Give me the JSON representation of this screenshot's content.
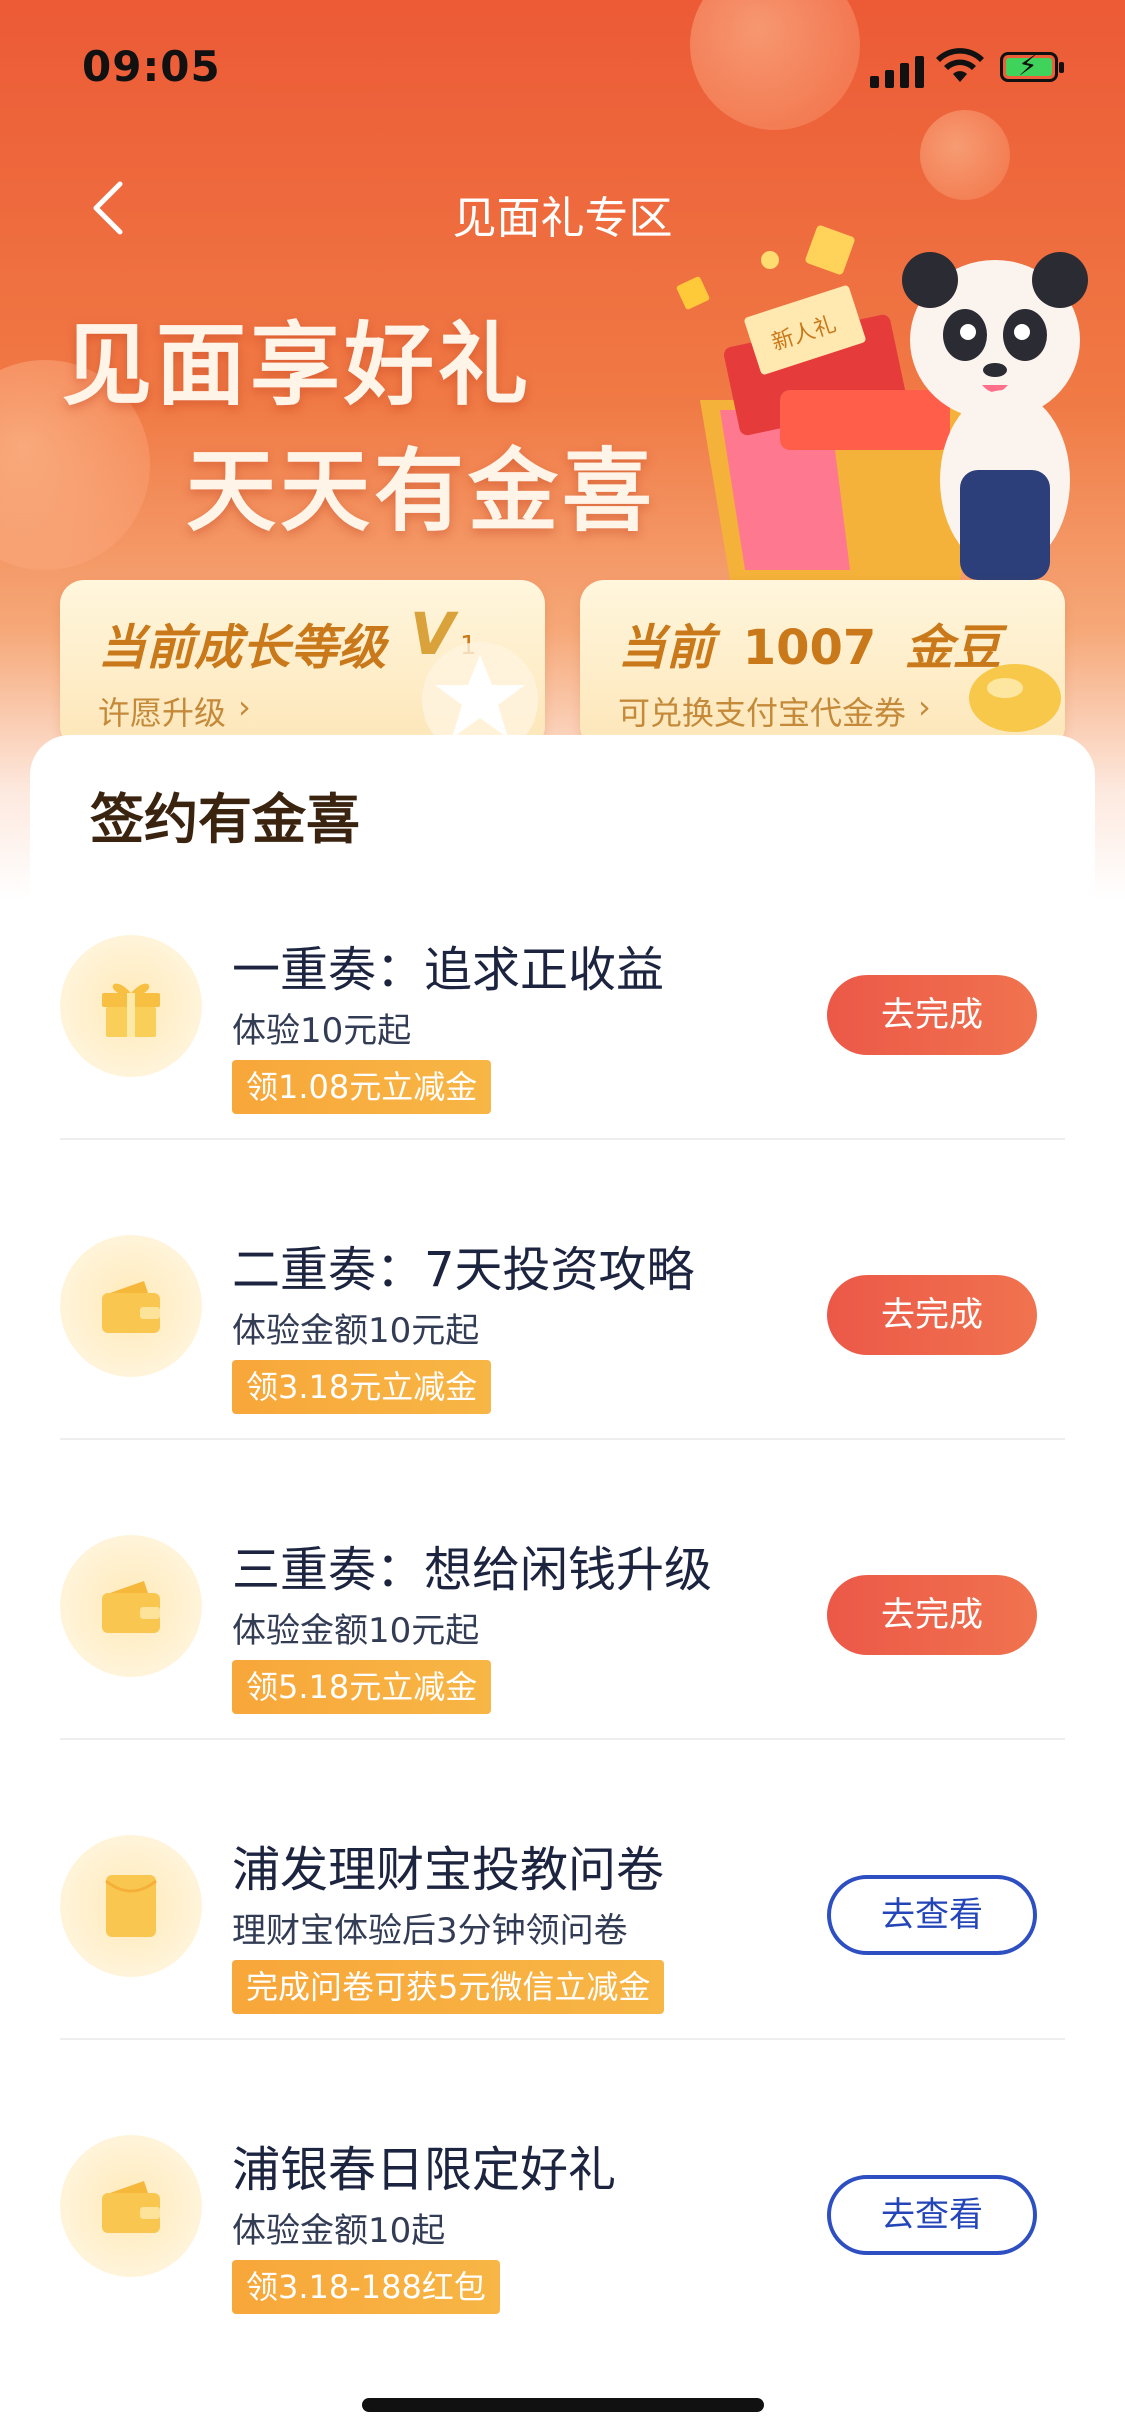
{
  "status_bar": {
    "time": "09:05"
  },
  "nav": {
    "title": "见面礼专区"
  },
  "hero": {
    "slogan_line1": "见面享好礼",
    "slogan_line2": "天天有金喜",
    "mascot_tag": "新人礼"
  },
  "growth_card": {
    "title": "当前成长等级",
    "level_badge": "V",
    "level_sub": "1",
    "link": "许愿升级"
  },
  "bean_card": {
    "prefix": "当前",
    "amount": "1007",
    "unit": "金豆",
    "link": "可兑换支付宝代金券"
  },
  "section": {
    "title": "签约有金喜"
  },
  "tasks": [
    {
      "icon": "gift-icon",
      "title": "一重奏：追求正收益",
      "subtitle": "体验10元起",
      "tag": "领1.08元立减金",
      "button": "去完成",
      "button_style": "done"
    },
    {
      "icon": "wallet-icon",
      "title": "二重奏：7天投资攻略",
      "subtitle": "体验金额10元起",
      "tag": "领3.18元立减金",
      "button": "去完成",
      "button_style": "done"
    },
    {
      "icon": "wallet-icon",
      "title": "三重奏：想给闲钱升级",
      "subtitle": "体验金额10元起",
      "tag": "领5.18元立减金",
      "button": "去完成",
      "button_style": "done"
    },
    {
      "icon": "envelope-icon",
      "title": "浦发理财宝投教问卷",
      "subtitle": "理财宝体验后3分钟领问卷",
      "tag": "完成问卷可获5元微信立减金",
      "button": "去查看",
      "button_style": "view"
    },
    {
      "icon": "wallet-icon",
      "title": "浦银春日限定好礼",
      "subtitle": "体验金额10起",
      "tag": "领3.18-188红包",
      "button": "去查看",
      "button_style": "view"
    }
  ],
  "colors": {
    "accent_red": "#ec5848",
    "view_blue": "#2e4fc2",
    "tag_orange": "#f8a73a"
  }
}
